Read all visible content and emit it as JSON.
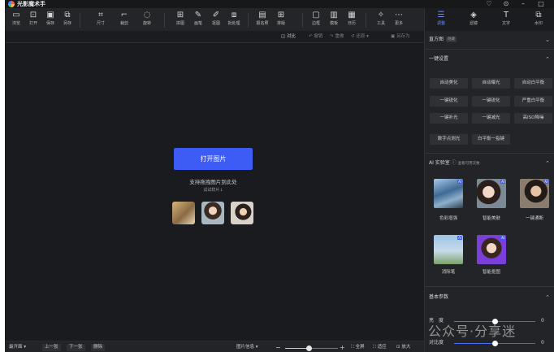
{
  "app": {
    "title": "光影魔术手"
  },
  "window_controls": [
    "gift-icon",
    "settings-icon",
    "minimize-icon",
    "maximize-icon"
  ],
  "toolbar": {
    "tools": [
      {
        "label": "浏览",
        "icon": "browse-icon"
      },
      {
        "label": "打开",
        "icon": "open-icon"
      },
      {
        "label": "保存",
        "icon": "save-icon"
      },
      {
        "label": "另存",
        "icon": "save-as-icon"
      },
      {
        "label": "尺寸",
        "icon": "resize-icon"
      },
      {
        "label": "裁剪",
        "icon": "crop-icon"
      },
      {
        "label": "旋转",
        "icon": "rotate-icon"
      },
      {
        "label": "拼图",
        "icon": "collage-icon"
      },
      {
        "label": "画笔",
        "icon": "brush-icon"
      },
      {
        "label": "抠图",
        "icon": "cutout-icon"
      },
      {
        "label": "批处理",
        "icon": "batch-icon"
      },
      {
        "label": "报名照",
        "icon": "id-photo-icon"
      },
      {
        "label": "排版",
        "icon": "layout-icon"
      },
      {
        "label": "边框",
        "icon": "border-icon"
      },
      {
        "label": "模板",
        "icon": "template-icon"
      },
      {
        "label": "日历",
        "icon": "calendar-icon"
      },
      {
        "label": "工具",
        "icon": "tools-icon"
      },
      {
        "label": "更多",
        "icon": "more-icon"
      }
    ]
  },
  "subbar": {
    "compare": "对比",
    "undo": "撤销",
    "redo": "重做",
    "restore": "还原",
    "save_as": "另存为"
  },
  "canvas": {
    "open_button": "打开图片",
    "drag_hint": "支持拖拽图片到此处",
    "try_hint": "试试样片↓"
  },
  "statusbar": {
    "display_mode": "最开面",
    "prev": "上一张",
    "next": "下一张",
    "delete": "删除",
    "image_info": "图片信息",
    "fit": "全屏",
    "actual": "适应",
    "zoom_in": "放大",
    "zoom_fraction": 0.45
  },
  "right_panel": {
    "tabs": [
      {
        "label": "调整",
        "icon": "adjust-icon",
        "active": true
      },
      {
        "label": "滤镜",
        "icon": "filter-icon",
        "active": false
      },
      {
        "label": "文字",
        "icon": "text-icon",
        "active": false
      },
      {
        "label": "水印",
        "icon": "watermark-icon",
        "active": false
      }
    ],
    "histogram": {
      "title": "直方图",
      "tag": "隐藏"
    },
    "one_click": {
      "title": "一键设置",
      "buttons": [
        "自动美化",
        "自动曝光",
        "自动白平衡",
        "一键锐化",
        "一键锐化",
        "严重白平衡",
        "一键补光",
        "一键减光",
        "高ISO降噪",
        "数字点测光",
        "白平衡一指键"
      ]
    },
    "ai_lab": {
      "title": "AI 实验室",
      "help": "查看可用次数",
      "badge": "AI",
      "items": [
        "色彩增强",
        "智能美肤",
        "一键通断",
        "消除笔",
        "智能抠图"
      ]
    },
    "basic": {
      "title": "基本参数",
      "brightness_label": "亮　度",
      "brightness_value": "0",
      "brightness_fraction": 0.5,
      "contrast_label": "对比度",
      "contrast_value": "0",
      "contrast_fraction": 0.5
    }
  },
  "watermark_text": "公众号·分享迷",
  "colors": {
    "accent": "#3d5bf5",
    "panel": "#232427",
    "canvas": "#1a1b1e"
  }
}
